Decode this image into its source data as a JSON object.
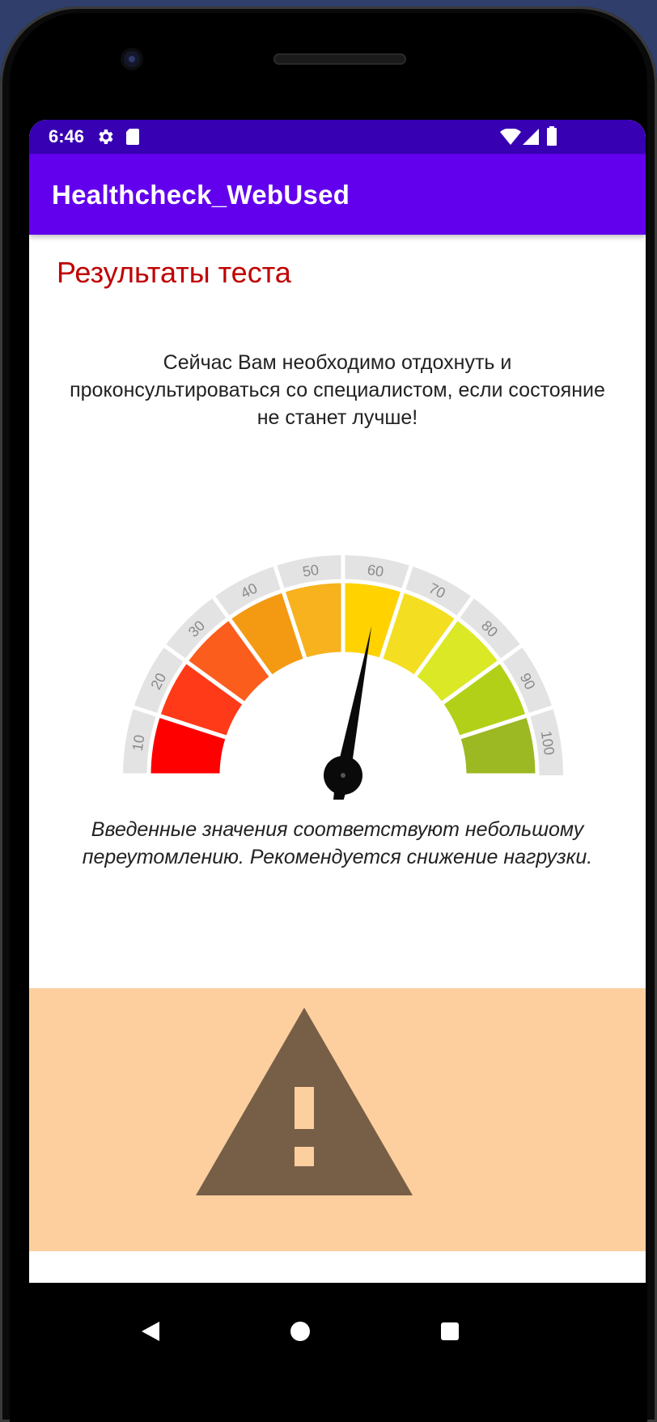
{
  "status_bar": {
    "time": "6:46",
    "icons": [
      "gear-icon",
      "sd-card-icon",
      "wifi-icon",
      "cell-signal-icon",
      "battery-icon"
    ]
  },
  "app_bar": {
    "title": "Healthcheck_WebUsed"
  },
  "content": {
    "title": "Результаты теста",
    "advice": "Сейчас Вам необходимо отдохнуть и проконсультироваться со специалистом, если состояние не станет лучше!",
    "verdict": "Введенные значения соответствуют небольшому переутомлению. Рекомендуется снижение нагрузки."
  },
  "gauge": {
    "ticks": [
      "10",
      "20",
      "30",
      "40",
      "50",
      "60",
      "70",
      "80",
      "90",
      "100"
    ],
    "segment_colors": [
      "#ff0000",
      "#ff3a18",
      "#fb5d1c",
      "#f39a12",
      "#f7b21e",
      "#ffd200",
      "#f4de21",
      "#dbe825",
      "#b3d018",
      "#9cb822"
    ],
    "value": 56
  },
  "warning": {
    "icon": "warning-icon",
    "background_color": "#fdcf9f",
    "icon_color": "#775f47"
  },
  "nav_bar": {
    "buttons": [
      "back-icon",
      "home-icon",
      "recents-icon"
    ]
  }
}
